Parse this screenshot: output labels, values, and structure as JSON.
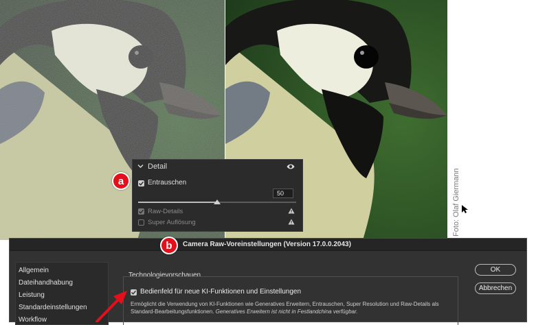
{
  "credit": "Foto: Olaf Giermann",
  "badges": {
    "a": "a",
    "b": "b"
  },
  "detail_panel": {
    "title": "Detail",
    "denoise": {
      "label": "Entrauschen",
      "checked": true,
      "value": "50",
      "fraction": 0.5
    },
    "raw_details": {
      "label": "Raw-Details",
      "checked": true,
      "enabled": false
    },
    "super_resolution": {
      "label": "Super Auflösung",
      "checked": false,
      "enabled": false
    }
  },
  "dialog": {
    "title": "Camera Raw-Voreinstellungen  (Version 17.0.0.2043)",
    "sidebar": [
      "Allgemein",
      "Dateihandhabung",
      "Leistung",
      "Standardeinstellungen",
      "Workflow"
    ],
    "section_title": "Technologievorschauen",
    "ai_checkbox": {
      "label": "Bedienfeld für neue KI-Funktionen und Einstellungen",
      "checked": true
    },
    "ai_description_1": "Ermöglicht die Verwendung von KI-Funktionen wie Generatives Erweitern, Entrauschen, Super Resolution und Raw-Details als Standard-Bearbeitungsfunktionen. ",
    "ai_description_2": "Generatives Erweitern ist nicht in Festlandchina verfügbar.",
    "ok_label": "OK",
    "cancel_label": "Abbrechen"
  },
  "colors": {
    "accent_red": "#e3101c",
    "dialog_bg": "#323232",
    "panel_bg": "#2b2b2b"
  },
  "icons": [
    "chevron-down-icon",
    "eye-icon",
    "warning-icon",
    "cursor-arrow-icon",
    "red-arrow-icon"
  ]
}
